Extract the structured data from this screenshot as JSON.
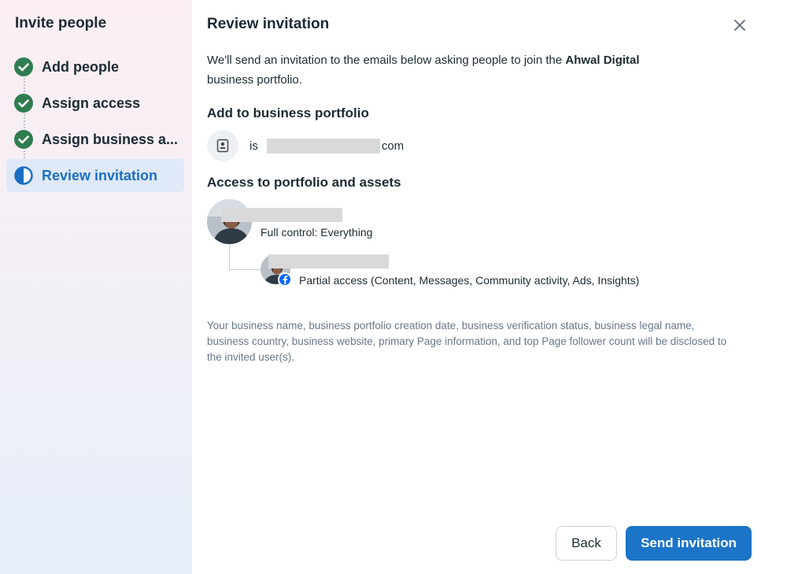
{
  "sidebar": {
    "title": "Invite people",
    "steps": [
      {
        "label": "Add people",
        "status": "complete",
        "icon": "check-circle-icon"
      },
      {
        "label": "Assign access",
        "status": "complete",
        "icon": "check-circle-icon"
      },
      {
        "label": "Assign business a...",
        "status": "complete",
        "icon": "check-circle-icon"
      },
      {
        "label": "Review invitation",
        "status": "current",
        "icon": "half-circle-icon"
      }
    ]
  },
  "main": {
    "title": "Review invitation",
    "intro_text": "We'll send an invitation to the emails below asking people to join the ",
    "business_name": "Ahwal Digital",
    "intro_suffix": "business portfolio.",
    "add_section_title": "Add to business portfolio",
    "email": {
      "prefix": "is",
      "suffix": "com",
      "icon": "contact-card-icon"
    },
    "access_section_title": "Access to portfolio and assets",
    "access_items": [
      {
        "access": "Full control: Everything"
      },
      {
        "access": "Partial access (Content, Messages, Community activity, Ads, Insights)",
        "badge_icon": "facebook-icon"
      }
    ],
    "disclosure": "Your business name, business portfolio creation date, business verification status, business legal name, business country, business website, primary Page information, and top Page follower count will be disclosed to the invited user(s).",
    "buttons": {
      "back": "Back",
      "send": "Send invitation"
    }
  },
  "colors": {
    "accent": "#1b74c7",
    "check_green": "#2f7d4f",
    "active_step_bg": "#dfe9f7",
    "active_step_text": "#1b6fc2"
  }
}
